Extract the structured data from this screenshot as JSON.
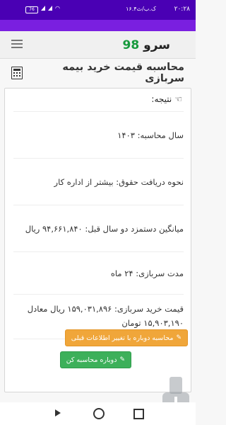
{
  "statusbar": {
    "time": "۲۰:۲۸",
    "speed": "۱۶.۴ک.ب/ث",
    "battery": "76"
  },
  "app": {
    "brand_text": "سرو",
    "brand_number": "98"
  },
  "page": {
    "title": "محاسبه قیمت خرید بیمه سربازی"
  },
  "result": {
    "header": "نتیجه:",
    "year": "سال محاسبه: ۱۴۰۳",
    "salary_method": "نحوه دریافت حقوق: بیشتر از اداره کار",
    "avg_salary": "میانگین دستمزد دو سال قبل: ۹۴,۶۶۱,۸۴۰ ریال",
    "service_duration": "مدت سربازی: ۲۴ ماه",
    "price": "قیمت خرید سربازی: ۱۵۹,۰۳۱,۸۹۶ ریال معادل ۱۵,۹۰۳,۱۹۰ تومان"
  },
  "buttons": {
    "recalc_change": "محاسبه دوباره با تغییر اطلاعات قبلی",
    "recalc": "دوباره محاسبه کن"
  },
  "colors": {
    "statusbar": "#4a00b4",
    "accent_green": "#169a3c",
    "button_orange": "#f0a63a",
    "button_green": "#3db05a"
  }
}
